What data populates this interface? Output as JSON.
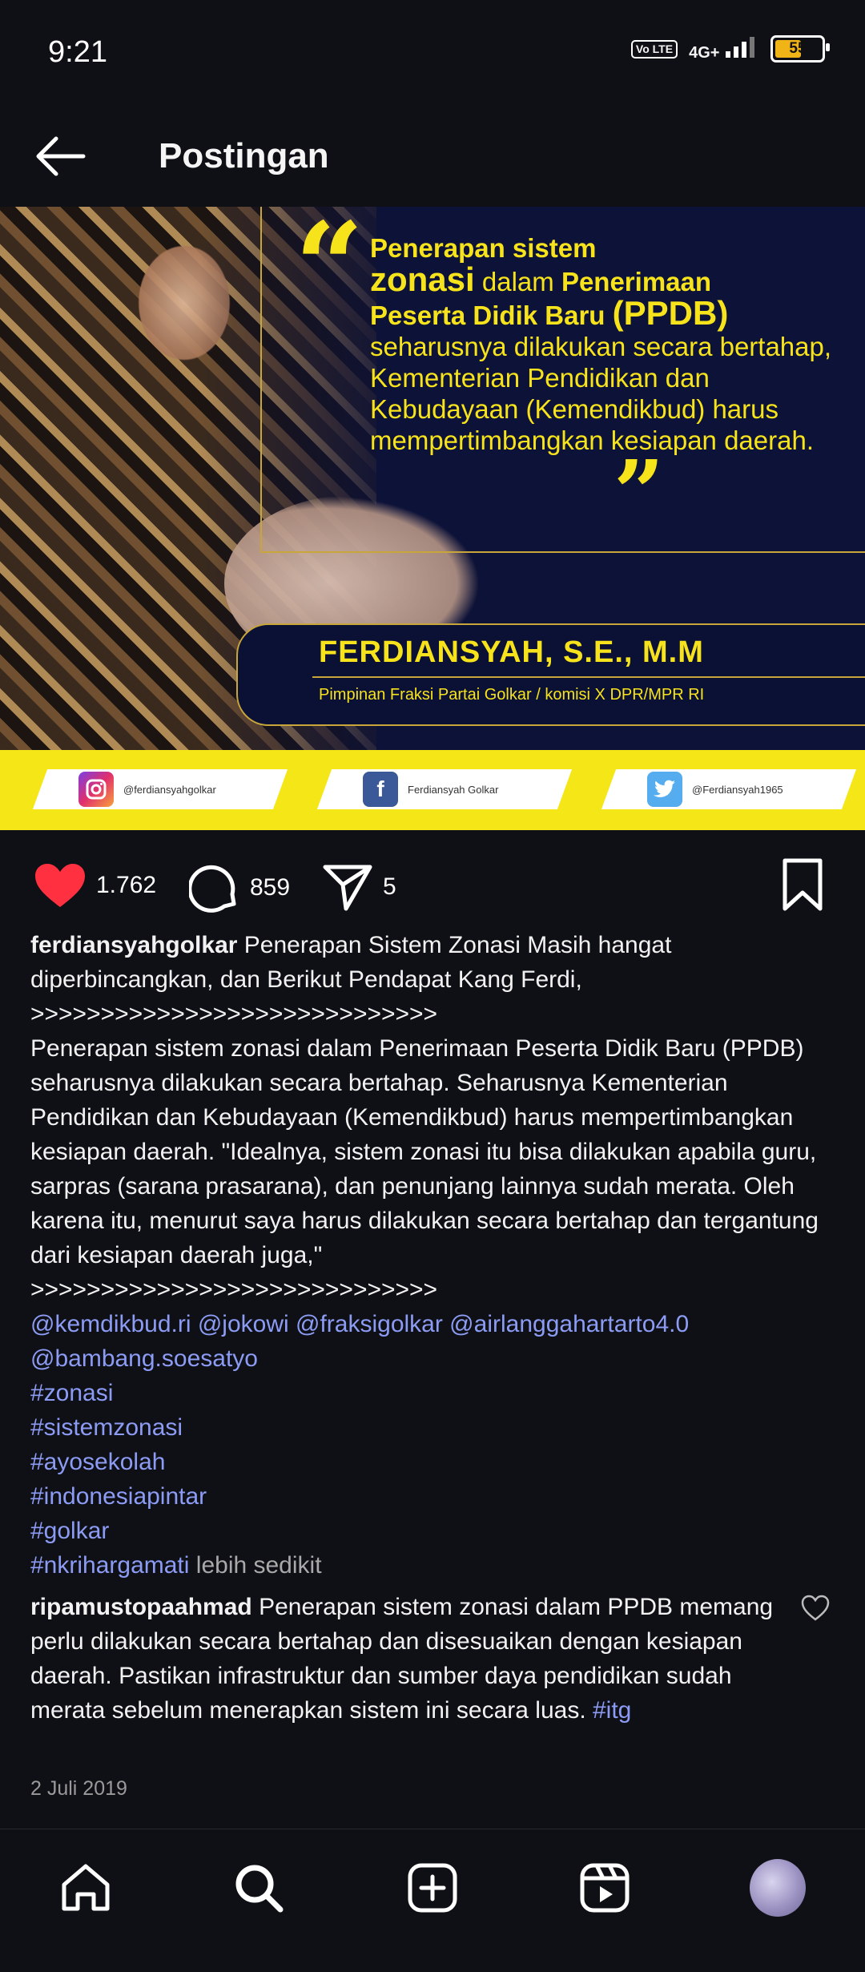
{
  "status_bar": {
    "time": "9:21",
    "volte": "Vo LTE",
    "network": "4G+",
    "battery": "55"
  },
  "header": {
    "title": "Postingan"
  },
  "post_image": {
    "quote_parts": [
      "Penerapan sistem",
      "zonasi",
      "dalam",
      "Penerimaan",
      "Peserta Didik Baru",
      "(PPDB)",
      "seharusnya dilakukan secara bertahap, Kementerian Pendidikan dan Kebudayaan (Kemendikbud) harus mempertimbangkan kesiapan daerah."
    ],
    "name": "FERDIANSYAH, S.E., M.M",
    "subtitle": "Pimpinan Fraksi Partai Golkar / komisi X DPR/MPR RI",
    "socials": [
      {
        "icon": "instagram-icon",
        "handle": "@ferdiansyahgolkar"
      },
      {
        "icon": "facebook-icon",
        "handle": "Ferdiansyah Golkar"
      },
      {
        "icon": "twitter-icon",
        "handle": "@Ferdiansyah1965"
      }
    ]
  },
  "actions": {
    "likes": "1.762",
    "comments": "859",
    "shares": "5"
  },
  "caption": {
    "username": "ferdiansyahgolkar",
    "intro": "Penerapan Sistem Zonasi Masih hangat diperbincangkan, dan Berikut Pendapat Kang Ferdi,",
    "divider": ">>>>>>>>>>>>>>>>>>>>>>>>>>>>>",
    "body": "Penerapan sistem zonasi dalam Penerimaan Peserta Didik Baru (PPDB) seharusnya dilakukan secara bertahap. Seharusnya Kementerian Pendidikan dan Kebudayaan (Kemendikbud) harus mempertimbangkan kesiapan daerah. \"Idealnya, sistem zonasi itu bisa dilakukan apabila guru, sarpras (sarana prasarana), dan penunjang lainnya sudah merata. Oleh karena itu, menurut saya harus dilakukan secara bertahap dan tergantung dari kesiapan daerah juga,\"",
    "divider2": ">>>>>>>>>>>>>>>>>>>>>>>>>>>>>",
    "mentions_line1": "@kemdikbud.ri @jokowi @fraksigolkar @airlanggahartarto4.0",
    "mentions_line2": "@bambang.soesatyo",
    "hashtags": [
      "#zonasi",
      "#sistemzonasi",
      "#ayosekolah",
      "#indonesiapintar",
      "#golkar",
      "#nkrihargamati"
    ],
    "less": "lebih sedikit"
  },
  "comment": {
    "username": "ripamustopaahmad",
    "text": "Penerapan sistem zonasi dalam PPDB memang perlu dilakukan secara bertahap dan disesuaikan dengan kesiapan daerah. Pastikan infrastruktur dan sumber daya pendidikan sudah merata sebelum menerapkan sistem ini secara luas.",
    "tag": "#itg"
  },
  "date": "2 Juli 2019",
  "nav": [
    "home-icon",
    "search-icon",
    "create-icon",
    "reels-icon",
    "profile-avatar"
  ],
  "colors": {
    "background": "#0f1015",
    "accent_yellow": "#f7e31c",
    "link": "#8c9cf5",
    "like_red": "#ff3040"
  }
}
